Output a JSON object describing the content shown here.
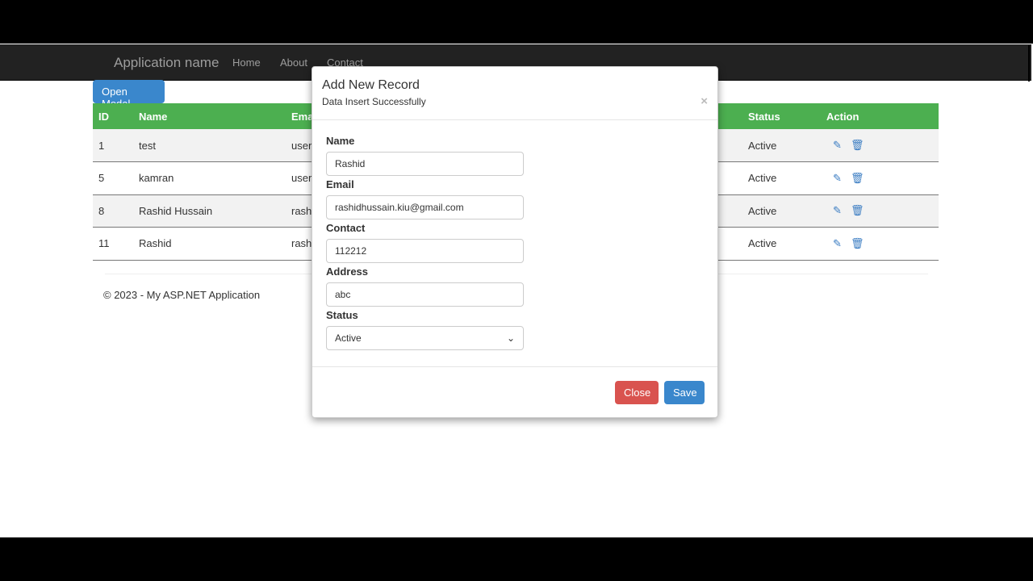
{
  "navbar": {
    "brand": "Application name",
    "links": [
      "Home",
      "About",
      "Contact"
    ]
  },
  "open_modal": "Open Modal",
  "table": {
    "headers": [
      "ID",
      "Name",
      "Email",
      "Status",
      "Action"
    ],
    "rows": [
      {
        "id": "1",
        "name": "test",
        "email": "user",
        "status": "Active"
      },
      {
        "id": "5",
        "name": "kamran",
        "email": "user",
        "status": "Active"
      },
      {
        "id": "8",
        "name": "Rashid Hussain",
        "email": "rash",
        "status": "Active"
      },
      {
        "id": "11",
        "name": "Rashid",
        "email": "rash",
        "status": "Active"
      }
    ]
  },
  "footer": "© 2023 - My ASP.NET Application",
  "modal": {
    "title": "Add New Record",
    "message": "Data Insert Successfully",
    "close_x": "×",
    "fields": {
      "name_label": "Name",
      "name": "Rashid",
      "email_label": "Email",
      "email": "rashidhussain.kiu@gmail.com",
      "contact_label": "Contact",
      "contact": "112212",
      "address_label": "Address",
      "address": "abc",
      "status_label": "Status",
      "status": "Active"
    },
    "close": "Close",
    "save": "Save"
  },
  "colors": {
    "header": "#4caf50",
    "primary": "#3a87cc",
    "danger": "#d9534f"
  }
}
